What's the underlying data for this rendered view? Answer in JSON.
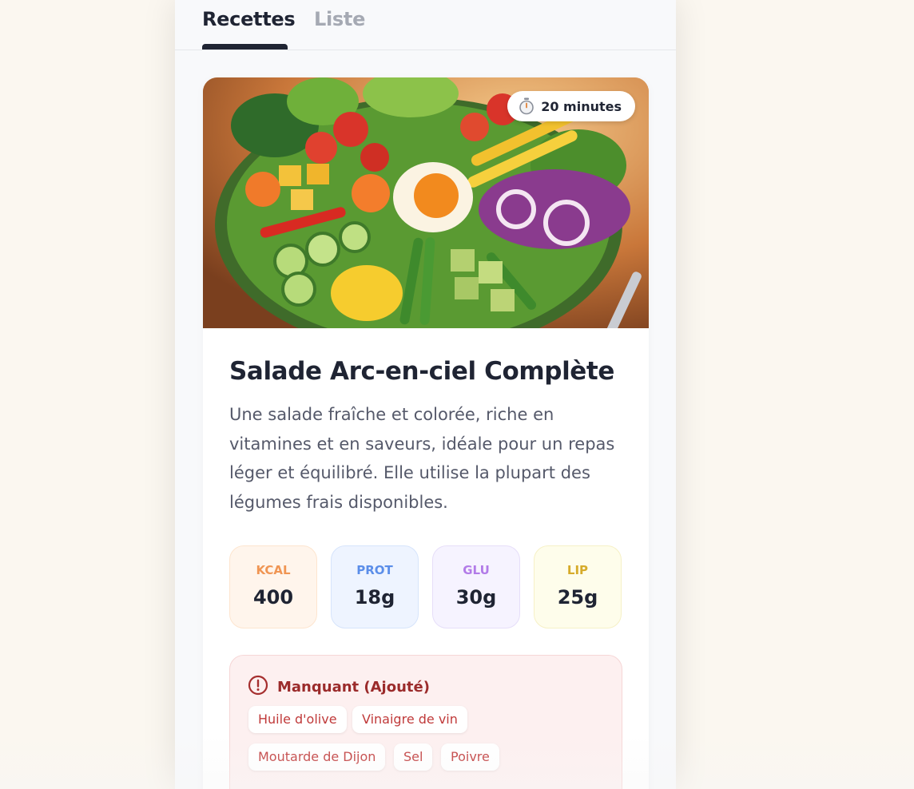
{
  "tabs": [
    {
      "label": "Recettes",
      "active": true
    },
    {
      "label": "Liste",
      "active": false
    }
  ],
  "recipe": {
    "time": "20 minutes",
    "time_icon": "stopwatch-icon",
    "title": "Salade Arc-en-ciel Complète",
    "description": "Une salade fraîche et colorée, riche en vitamines et en saveurs, idéale pour un repas léger et équilibré. Elle utilise la plupart des légumes frais disponibles.",
    "macros": [
      {
        "label": "KCAL",
        "value": "400",
        "color": "#f09553"
      },
      {
        "label": "PROT",
        "value": "18g",
        "color": "#5b8ee9"
      },
      {
        "label": "GLU",
        "value": "30g",
        "color": "#b27be8"
      },
      {
        "label": "LIP",
        "value": "25g",
        "color": "#d6ab2a"
      }
    ],
    "missing": {
      "title": "Manquant (Ajouté)",
      "icon": "alert-circle-icon",
      "items": [
        "Huile d'olive",
        "Vinaigre de vin",
        "Moutarde de Dijon",
        "Sel",
        "Poivre"
      ]
    }
  },
  "colors": {
    "accent": "#1f2433",
    "missing_text": "#9b2b2b",
    "chip_text": "#c03a3a"
  }
}
